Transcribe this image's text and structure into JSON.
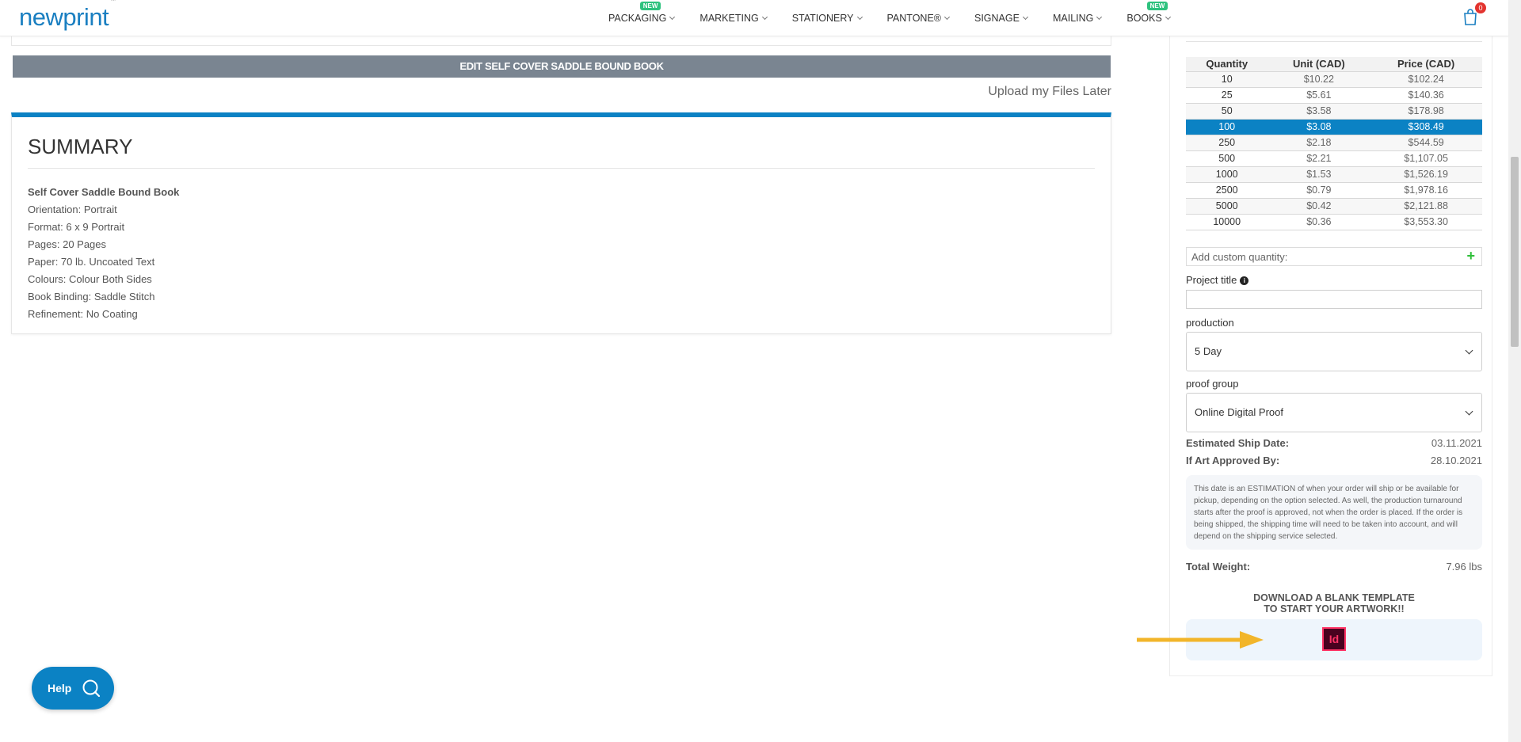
{
  "header": {
    "logo": "newprint",
    "logo_tm": "™",
    "nav": [
      {
        "label": "PACKAGING",
        "badge": "NEW"
      },
      {
        "label": "MARKETING",
        "badge": ""
      },
      {
        "label": "STATIONERY",
        "badge": ""
      },
      {
        "label": "PANTONE®",
        "badge": ""
      },
      {
        "label": "SIGNAGE",
        "badge": ""
      },
      {
        "label": "MAILING",
        "badge": ""
      },
      {
        "label": "BOOKS",
        "badge": "NEW"
      }
    ],
    "cart_count": "0"
  },
  "main": {
    "edit_button": "EDIT SELF COVER SADDLE BOUND BOOK",
    "upload_later": "Upload my Files Later",
    "summary": {
      "title": "SUMMARY",
      "product": "Self Cover Saddle Bound Book",
      "lines": [
        "Orientation: Portrait",
        "Format: 6 x 9 Portrait",
        "Pages: 20 Pages",
        "Paper: 70 lb. Uncoated Text",
        "Colours: Colour Both Sides",
        "Book Binding: Saddle Stitch",
        "Refinement: No Coating"
      ]
    }
  },
  "panel": {
    "table": {
      "headers": [
        "Quantity",
        "Unit (CAD)",
        "Price (CAD)"
      ],
      "rows": [
        [
          "10",
          "$10.22",
          "$102.24"
        ],
        [
          "25",
          "$5.61",
          "$140.36"
        ],
        [
          "50",
          "$3.58",
          "$178.98"
        ],
        [
          "100",
          "$3.08",
          "$308.49"
        ],
        [
          "250",
          "$2.18",
          "$544.59"
        ],
        [
          "500",
          "$2.21",
          "$1,107.05"
        ],
        [
          "1000",
          "$1.53",
          "$1,526.19"
        ],
        [
          "2500",
          "$0.79",
          "$1,978.16"
        ],
        [
          "5000",
          "$0.42",
          "$2,121.88"
        ],
        [
          "10000",
          "$0.36",
          "$3,553.30"
        ]
      ],
      "selected_quantity": "100"
    },
    "custom_quantity_placeholder": "Add custom quantity:",
    "project_title_label": "Project title",
    "production_label": "production",
    "production_value": "5 Day",
    "proof_group_label": "proof group",
    "proof_group_value": "Online Digital Proof",
    "ship_date_label": "Estimated Ship Date:",
    "ship_date_value": "03.11.2021",
    "art_approved_label": "If Art Approved By:",
    "art_approved_value": "28.10.2021",
    "note": "This date is an ESTIMATION of when your order will ship or be available for pickup, depending on the option selected. As well, the production turnaround starts after the proof is approved, not when the order is placed. If the order is being shipped, the shipping time will need to be taken into account, and will depend on the shipping service selected.",
    "total_weight_label": "Total Weight:",
    "total_weight_value": "7.96 lbs",
    "download_title_line1": "DOWNLOAD A BLANK TEMPLATE",
    "download_title_line2": "TO START YOUR ARTWORK!!",
    "template_icon_text": "Id"
  },
  "help": {
    "label": "Help"
  },
  "colors": {
    "accent": "#0b82c4",
    "edit_button": "#7a8591",
    "arrow": "#f2b52a",
    "badge_new": "#2ec27e"
  }
}
